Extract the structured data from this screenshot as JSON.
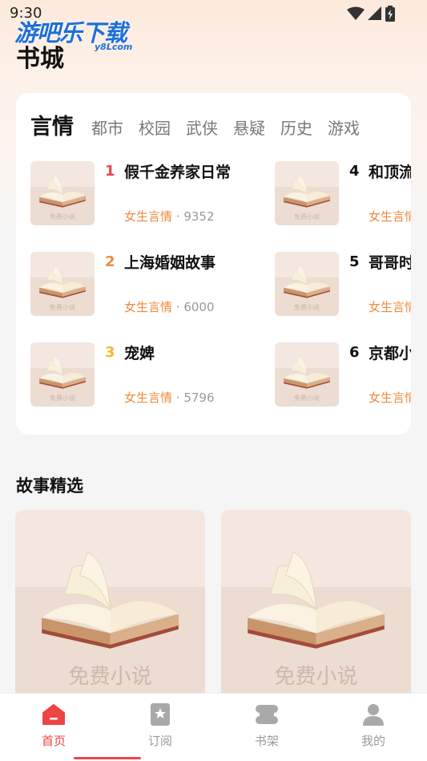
{
  "status_bar": {
    "time": "9:30"
  },
  "watermark": {
    "text": "游吧乐下载",
    "sub": "y8Lcom"
  },
  "header": {
    "title": "书城"
  },
  "categories": [
    {
      "label": "言情",
      "active": true
    },
    {
      "label": "都市"
    },
    {
      "label": "校园"
    },
    {
      "label": "武侠"
    },
    {
      "label": "悬疑"
    },
    {
      "label": "历史"
    },
    {
      "label": "游戏"
    }
  ],
  "ranking": [
    {
      "rank": "1",
      "title": "假千金养家日常",
      "tag": "女生言情",
      "sep": "·",
      "count": "9352",
      "rank_color": "#ef4444"
    },
    {
      "rank": "2",
      "title": "上海婚姻故事",
      "tag": "女生言情",
      "sep": "·",
      "count": "6000",
      "rank_color": "#f08a3c"
    },
    {
      "rank": "3",
      "title": "宠婢",
      "tag": "女生言情",
      "sep": "·",
      "count": "5796",
      "rank_color": "#f5b82e"
    },
    {
      "rank": "4",
      "title": "和顶流忆了",
      "tag": "女生言情",
      "sep": "",
      "count": "",
      "rank_color": "#111111"
    },
    {
      "rank": "5",
      "title": "哥哥时",
      "tag": "女生言情",
      "sep": "",
      "count": "",
      "rank_color": "#111111"
    },
    {
      "rank": "6",
      "title": "京都小",
      "tag": "女生言情",
      "sep": "",
      "count": "",
      "rank_color": "#111111"
    }
  ],
  "cover": {
    "watermark_text": "免费小说"
  },
  "stories_section": {
    "title": "故事精选"
  },
  "tabbar": [
    {
      "label": "首页",
      "icon": "home-icon",
      "active": true
    },
    {
      "label": "订阅",
      "icon": "bookmark-icon"
    },
    {
      "label": "书架",
      "icon": "bookshelf-icon"
    },
    {
      "label": "我的",
      "icon": "profile-icon"
    }
  ],
  "colors": {
    "accent": "#ef4444",
    "tag": "#f08a3c",
    "inactive": "#9a9a9a"
  }
}
